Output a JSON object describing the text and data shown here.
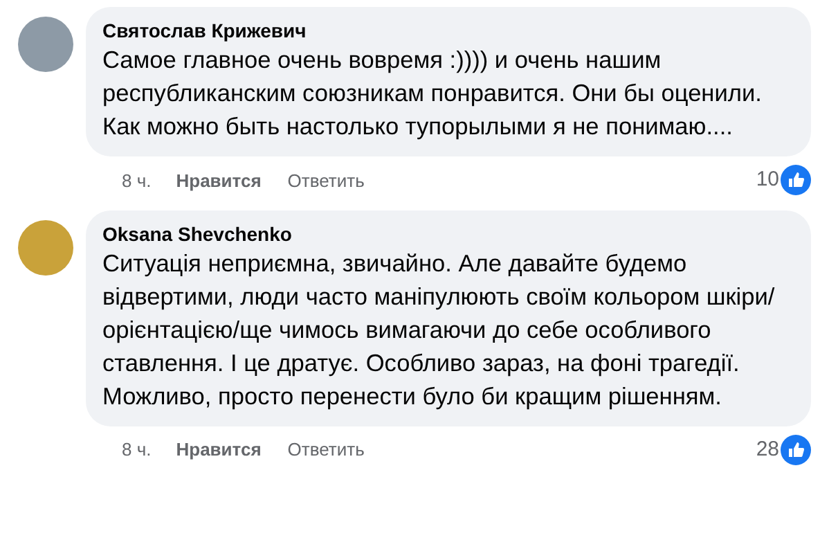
{
  "comments": [
    {
      "author": "Святослав Крижевич",
      "text": "Самое главное очень вовремя :)))) и очень нашим республиканским союзникам понравится. Они бы оценили. Как можно быть настолько тупорылыми я не понимаю....",
      "time": "8 ч.",
      "like": "Нравится",
      "reply": "Ответить",
      "reactions": "10"
    },
    {
      "author": "Oksana Shevchenko",
      "text": "Ситуація неприємна, звичайно. Але давайте будемо відвертими, люди часто маніпулюють своїм кольором шкіри/орієнтацією/ще чимось вимагаючи до себе особливого ставлення. І це дратує. Особливо зараз, на фоні трагедії. Можливо, просто перенести було би кращим рішенням.",
      "time": "8 ч.",
      "like": "Нравится",
      "reply": "Ответить",
      "reactions": "28"
    }
  ]
}
